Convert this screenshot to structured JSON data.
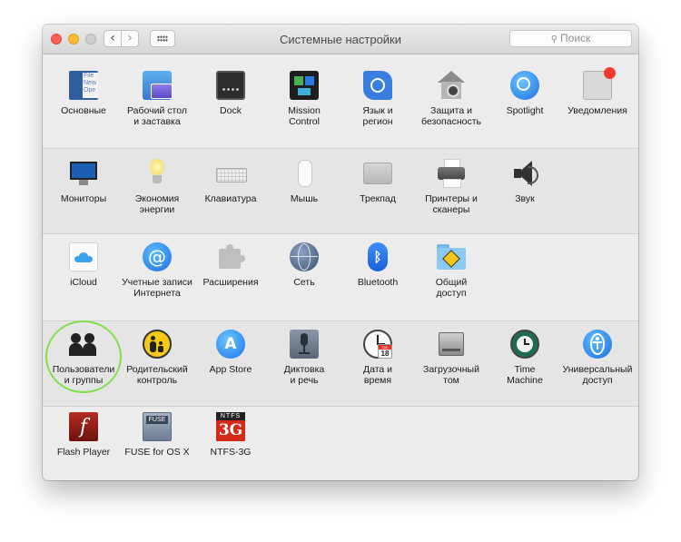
{
  "window": {
    "title": "Системные настройки"
  },
  "toolbar": {
    "back": "‹",
    "forward": "›"
  },
  "search": {
    "placeholder": "Поиск"
  },
  "rows": [
    [
      "Основные",
      "Рабочий стол\nи заставка",
      "Dock",
      "Mission\nControl",
      "Язык и\nрегион",
      "Защита и\nбезопасность",
      "Spotlight",
      "Уведомления"
    ],
    [
      "Мониторы",
      "Экономия\nэнергии",
      "Клавиатура",
      "Мышь",
      "Трекпад",
      "Принтеры и\nсканеры",
      "Звук"
    ],
    [
      "iCloud",
      "Учетные записи\nИнтернета",
      "Расширения",
      "Сеть",
      "Bluetooth",
      "Общий\nдоступ"
    ],
    [
      "Пользователи\nи группы",
      "Родительский\nконтроль",
      "App Store",
      "Диктовка\nи речь",
      "Дата и\nвремя",
      "Загрузочный\nтом",
      "Time\nMachine",
      "Универсальный\nдоступ"
    ],
    [
      "Flash Player",
      "FUSE for OS X",
      "NTFS-3G"
    ]
  ],
  "icon_text": {
    "file": "File",
    "new": "New",
    "ope": "Ope",
    "fuse": "FUSE",
    "ntfs": "NTFS",
    "three_g": "3G",
    "flash": "f",
    "date_month": "JUL",
    "date_day": "18"
  },
  "colors": {
    "highlight_ring": "#7fe04a",
    "accent_blue": "#1a82fb"
  }
}
